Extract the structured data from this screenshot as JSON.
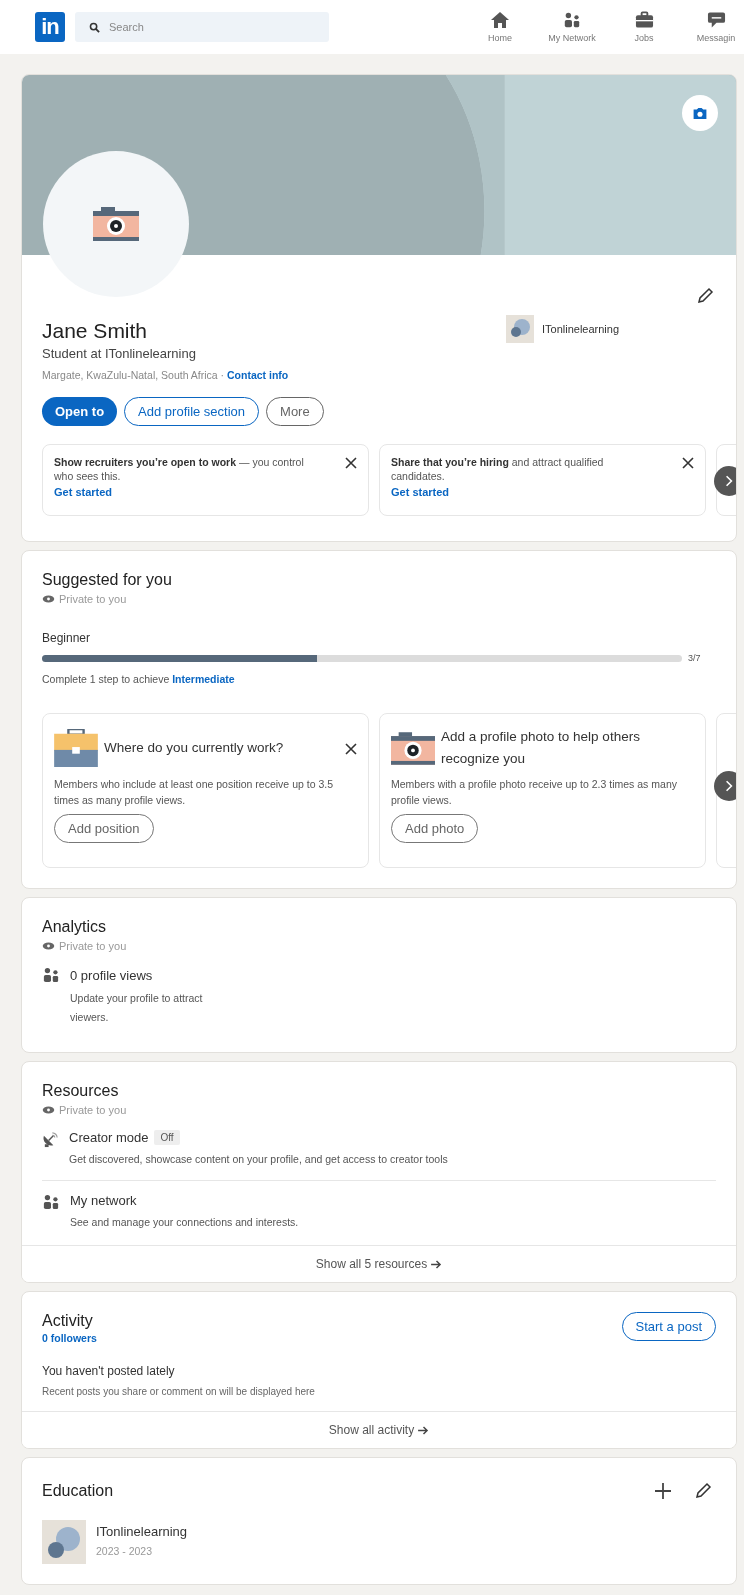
{
  "header": {
    "logo": "in",
    "search": {
      "placeholder": "Search"
    },
    "nav": [
      {
        "kind": "home",
        "label": "Home"
      },
      {
        "kind": "network",
        "label": "My Network"
      },
      {
        "kind": "jobs",
        "label": "Jobs"
      },
      {
        "kind": "messaging",
        "label": "Messagin"
      }
    ]
  },
  "profile": {
    "name": "Jane Smith",
    "headline": "Student at ITonlinelearning",
    "location": "Margate, KwaZulu-Natal, South Africa ·",
    "contact_link": "Contact info",
    "company": "ITonlinelearning",
    "buttons": [
      {
        "kind": "primary",
        "label": "Open to"
      },
      {
        "kind": "outline",
        "label": "Add profile section"
      },
      {
        "kind": "secondary",
        "label": "More"
      }
    ],
    "prompts": [
      {
        "text": "**Show recruiters you’re open to work** — you control who sees this.",
        "link": "Get started",
        "dismissible": true
      },
      {
        "text": "**Share that you’re hiring** and attract qualified candidates.",
        "link": "Get started",
        "dismissible": true
      }
    ]
  },
  "suggested": {
    "title": "Suggested for you",
    "privacy": "Private to you",
    "stage": "Beginner",
    "progress": {
      "level": 0.43,
      "reading": "3/7"
    },
    "hint": "Complete 1 step to achieve",
    "hint_link": "Intermediate",
    "cards": [
      {
        "kind": "briefcase",
        "title": "Where do you currently work?",
        "description": "Members who include at least one position receive up to 3.5 times as many profile views.",
        "button": "Add position",
        "dismissible": true
      },
      {
        "kind": "camera",
        "title": "Add a profile photo to help others recognize you",
        "description": "Members with a profile photo receive up to 2.3 times as many profile views.",
        "button": "Add photo",
        "dismissible": false
      }
    ]
  },
  "analytics": {
    "title": "Analytics",
    "privacy": "Private to you",
    "items": [
      {
        "kind": "people",
        "title": "0 profile views",
        "description": "Update your profile to attract viewers."
      }
    ]
  },
  "resources": {
    "title": "Resources",
    "privacy": "Private to you",
    "items": [
      {
        "kind": "creator",
        "title": "Creator mode",
        "badge": "Off",
        "description": "Get discovered, showcase content on your profile, and get access to creator tools"
      },
      {
        "kind": "people",
        "title": "My network",
        "description": "See and manage your connections and interests."
      }
    ],
    "footer": "Show all 5 resources"
  },
  "activity": {
    "title": "Activity",
    "followers": "0 followers",
    "button": "Start a post",
    "empty_title": "You haven't posted lately",
    "empty_description": "Recent posts you share or comment on will be displayed here",
    "footer": "Show all activity"
  },
  "education": {
    "title": "Education",
    "items": [
      {
        "school": "ITonlinelearning",
        "dates": "2023 - 2023"
      }
    ]
  }
}
